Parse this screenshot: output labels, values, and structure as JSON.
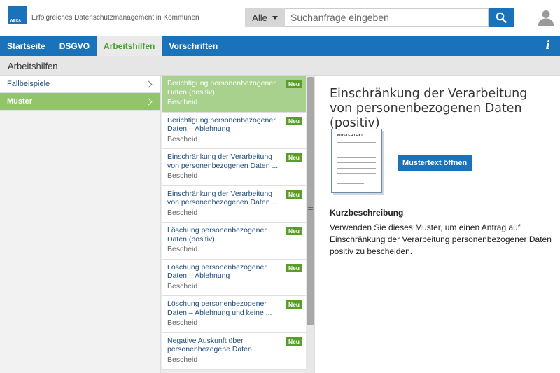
{
  "header": {
    "logo_text": "WEKA",
    "app_title": "Erfolgreiches Datenschutzmanagement in Kommunen",
    "search": {
      "scope": "Alle",
      "placeholder": "Suchanfrage eingeben",
      "value": ""
    }
  },
  "nav": {
    "items": [
      {
        "label": "Startseite"
      },
      {
        "label": "DSGVO"
      },
      {
        "label": "Arbeitshilfen",
        "active": true
      },
      {
        "label": "Vorschriften"
      }
    ],
    "info_label": "i"
  },
  "breadcrumb": {
    "title": "Arbeitshilfen"
  },
  "sidebar": {
    "items": [
      {
        "label": "Fallbeispiele",
        "active": false
      },
      {
        "label": "Muster",
        "active": true
      }
    ]
  },
  "list": {
    "badge_label": "Neu",
    "items": [
      {
        "title": "Berichtigung personenbezogener Daten (positiv)",
        "type": "Bescheid",
        "active": true
      },
      {
        "title": "Berichtigung personenbezogener Daten – Ablehnung",
        "type": "Bescheid"
      },
      {
        "title": "Einschränkung der Verarbeitung von personenbezogenen Daten ...",
        "type": "Bescheid"
      },
      {
        "title": "Einschränkung der Verarbeitung von personenbezogenen Daten ...",
        "type": "Bescheid"
      },
      {
        "title": "Löschung personenbezogener Daten (positiv)",
        "type": "Bescheid"
      },
      {
        "title": "Löschung personenbezogener Daten – Ablehnung",
        "type": "Bescheid"
      },
      {
        "title": "Löschung personenbezogener Daten – Ablehnung und keine ...",
        "type": "Bescheid"
      },
      {
        "title": "Negative Auskunft über personenbezogene Daten",
        "type": "Bescheid"
      }
    ]
  },
  "detail": {
    "title": "Einschränkung der Verarbeitung von personenbezogenen Daten (positiv)",
    "thumbnail_label": "MUSTERTEXT",
    "open_button": "Mustertext öffnen",
    "section_title": "Kurzbeschreibung",
    "description": "Verwenden Sie dieses Muster, um einen Antrag auf Einschränkung der Verarbeitung personenbezogener Daten positiv zu bescheiden."
  },
  "colors": {
    "brand_blue": "#1a72bb",
    "active_green": "#92c46b",
    "badge_green": "#5a9e26"
  }
}
